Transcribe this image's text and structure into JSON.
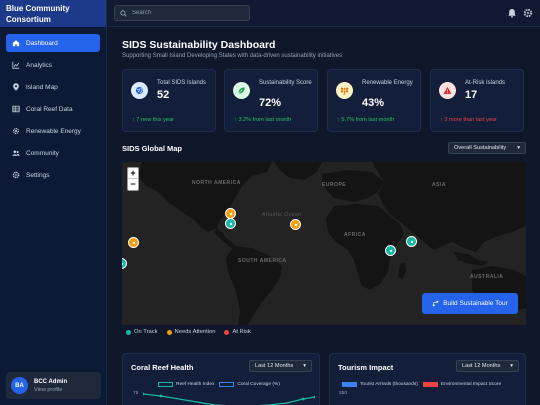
{
  "sidebar": {
    "brand": "Blue Community Consortium",
    "items": [
      {
        "label": "Dashboard",
        "icon": "home-icon",
        "active": true
      },
      {
        "label": "Analytics",
        "icon": "chart-line-icon"
      },
      {
        "label": "Island Map",
        "icon": "map-pin-icon"
      },
      {
        "label": "Coral Reef Data",
        "icon": "table-icon"
      },
      {
        "label": "Renewable Energy",
        "icon": "gear-icon"
      },
      {
        "label": "Community",
        "icon": "users-icon"
      },
      {
        "label": "Settings",
        "icon": "settings-icon"
      }
    ],
    "user": {
      "initials": "BA",
      "name": "BCC Admin",
      "link": "View profile"
    }
  },
  "topbar": {
    "search_placeholder": "Search",
    "icons": [
      "bell-icon",
      "settings-icon"
    ]
  },
  "main": {
    "title": "SIDS Sustainability Dashboard",
    "subtitle": "Supporting Small Island Developing States with data-driven sustainability initiatives",
    "stats": [
      {
        "label": "Total SIDS Islands",
        "value": "52",
        "trend": "↑ 7 new this year",
        "trend_dir": "up",
        "icon": "globe-icon",
        "icon_bg": "#dbeafe",
        "icon_color": "#2563eb"
      },
      {
        "label": "Sustainability Score",
        "value": "72%",
        "trend": "↑ 3.2% from last month",
        "trend_dir": "up",
        "icon": "leaf-icon",
        "icon_bg": "#dcfce7",
        "icon_color": "#16a34a"
      },
      {
        "label": "Renewable Energy",
        "value": "43%",
        "trend": "↑ 5.7% from last month",
        "trend_dir": "up",
        "icon": "solar-panel-icon",
        "icon_bg": "#fef3c7",
        "icon_color": "#d97706"
      },
      {
        "label": "At-Risk Islands",
        "value": "17",
        "trend": "↑ 2 more than last year",
        "trend_dir": "down",
        "icon": "warning-icon",
        "icon_bg": "#fee2e2",
        "icon_color": "#dc2626"
      }
    ],
    "map_section": {
      "title": "SIDS Global Map",
      "filter": "Overall Sustainability",
      "zoom_in": "+",
      "zoom_out": "−",
      "labels": {
        "north_america": "NORTH AMERICA",
        "south_america": "SOUTH AMERICA",
        "europe": "EUROPE",
        "africa": "AFRICA",
        "asia": "ASIA",
        "australia": "AUSTRALIA",
        "atlantic": "Atlantic Ocean"
      },
      "tour_button": "Build Sustainable Tour",
      "legend": [
        {
          "label": "On Track",
          "color": "#14b8a6"
        },
        {
          "label": "Needs Attention",
          "color": "#f59e0b"
        },
        {
          "label": "At Risk",
          "color": "#ef4444"
        }
      ]
    },
    "coral_panel": {
      "title": "Coral Reef Health",
      "filter": "Last 12 Months",
      "legend": [
        "Reef Health Index",
        "Coral Coverage (%)"
      ],
      "ytick": "75"
    },
    "tourism_panel": {
      "title": "Tourism Impact",
      "filter": "Last 12 Months",
      "legend": [
        "Tourist Arrivals (thousands)",
        "Environmental Impact Score"
      ],
      "ytick": "250"
    }
  }
}
